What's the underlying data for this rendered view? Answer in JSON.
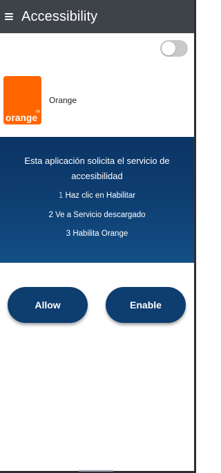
{
  "toolbar": {
    "title": "Accessibility",
    "menu_icon": "hamburger-menu-icon",
    "background": "#3d4348"
  },
  "toggle": {
    "state": "off",
    "track_color": "#c7c9cb"
  },
  "app": {
    "logo_text": "orange",
    "logo_color": "#ff6600",
    "name": "Orange"
  },
  "banner": {
    "message": "Esta aplicación solicita el servicio de accesibilidad",
    "steps": [
      {
        "num": "1",
        "text": "Haz clic en Habilitar"
      },
      {
        "num": "2",
        "text": "Ve a Servicio descargado"
      },
      {
        "num": "3",
        "text": "Habilita Orange"
      }
    ],
    "color": "#0e3d70"
  },
  "buttons": {
    "allow_label": "Allow",
    "enable_label": "Enable",
    "color": "#0e3d70"
  }
}
